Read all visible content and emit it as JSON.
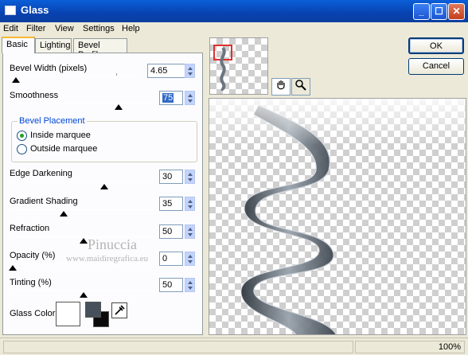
{
  "window": {
    "title": "Glass"
  },
  "menu": [
    "Edit",
    "Filter",
    "View",
    "Settings",
    "Help"
  ],
  "tabs": [
    "Basic",
    "Lighting",
    "Bevel Profile"
  ],
  "controls": {
    "bevel_width": {
      "label": "Bevel Width (pixels)",
      "value": "4.65",
      "slider_fraction": 0.02
    },
    "smoothness": {
      "label": "Smoothness",
      "value": "75",
      "slider_fraction": 0.75
    },
    "bevel_placement": {
      "title": "Bevel Placement",
      "options": [
        "Inside marquee",
        "Outside marquee"
      ],
      "selected": "Inside marquee"
    },
    "edge_darkening": {
      "label": "Edge Darkening",
      "value": "30",
      "slider_fraction": 0.3
    },
    "gradient_shading": {
      "label": "Gradient Shading",
      "value": "35",
      "slider_fraction": 0.35
    },
    "refraction": {
      "label": "Refraction",
      "value": "50",
      "slider_fraction": 0.5
    },
    "opacity": {
      "label": "Opacity (%)",
      "value": "0",
      "slider_fraction": 0.0
    },
    "tinting": {
      "label": "Tinting (%)",
      "value": "50",
      "slider_fraction": 0.5
    },
    "glass_color": {
      "label": "Glass Color",
      "color": "#ffffff",
      "fill_color": "#46505c"
    }
  },
  "buttons": {
    "ok": "OK",
    "cancel": "Cancel"
  },
  "watermark": {
    "name": "Pinuccia",
    "site": "www.maidiregrafica.eu"
  },
  "status": {
    "zoom": "100%"
  },
  "colors": {
    "title_bar": "#0a4fc4",
    "selection": "#316ac5",
    "glass_shape": "#4a545f"
  }
}
